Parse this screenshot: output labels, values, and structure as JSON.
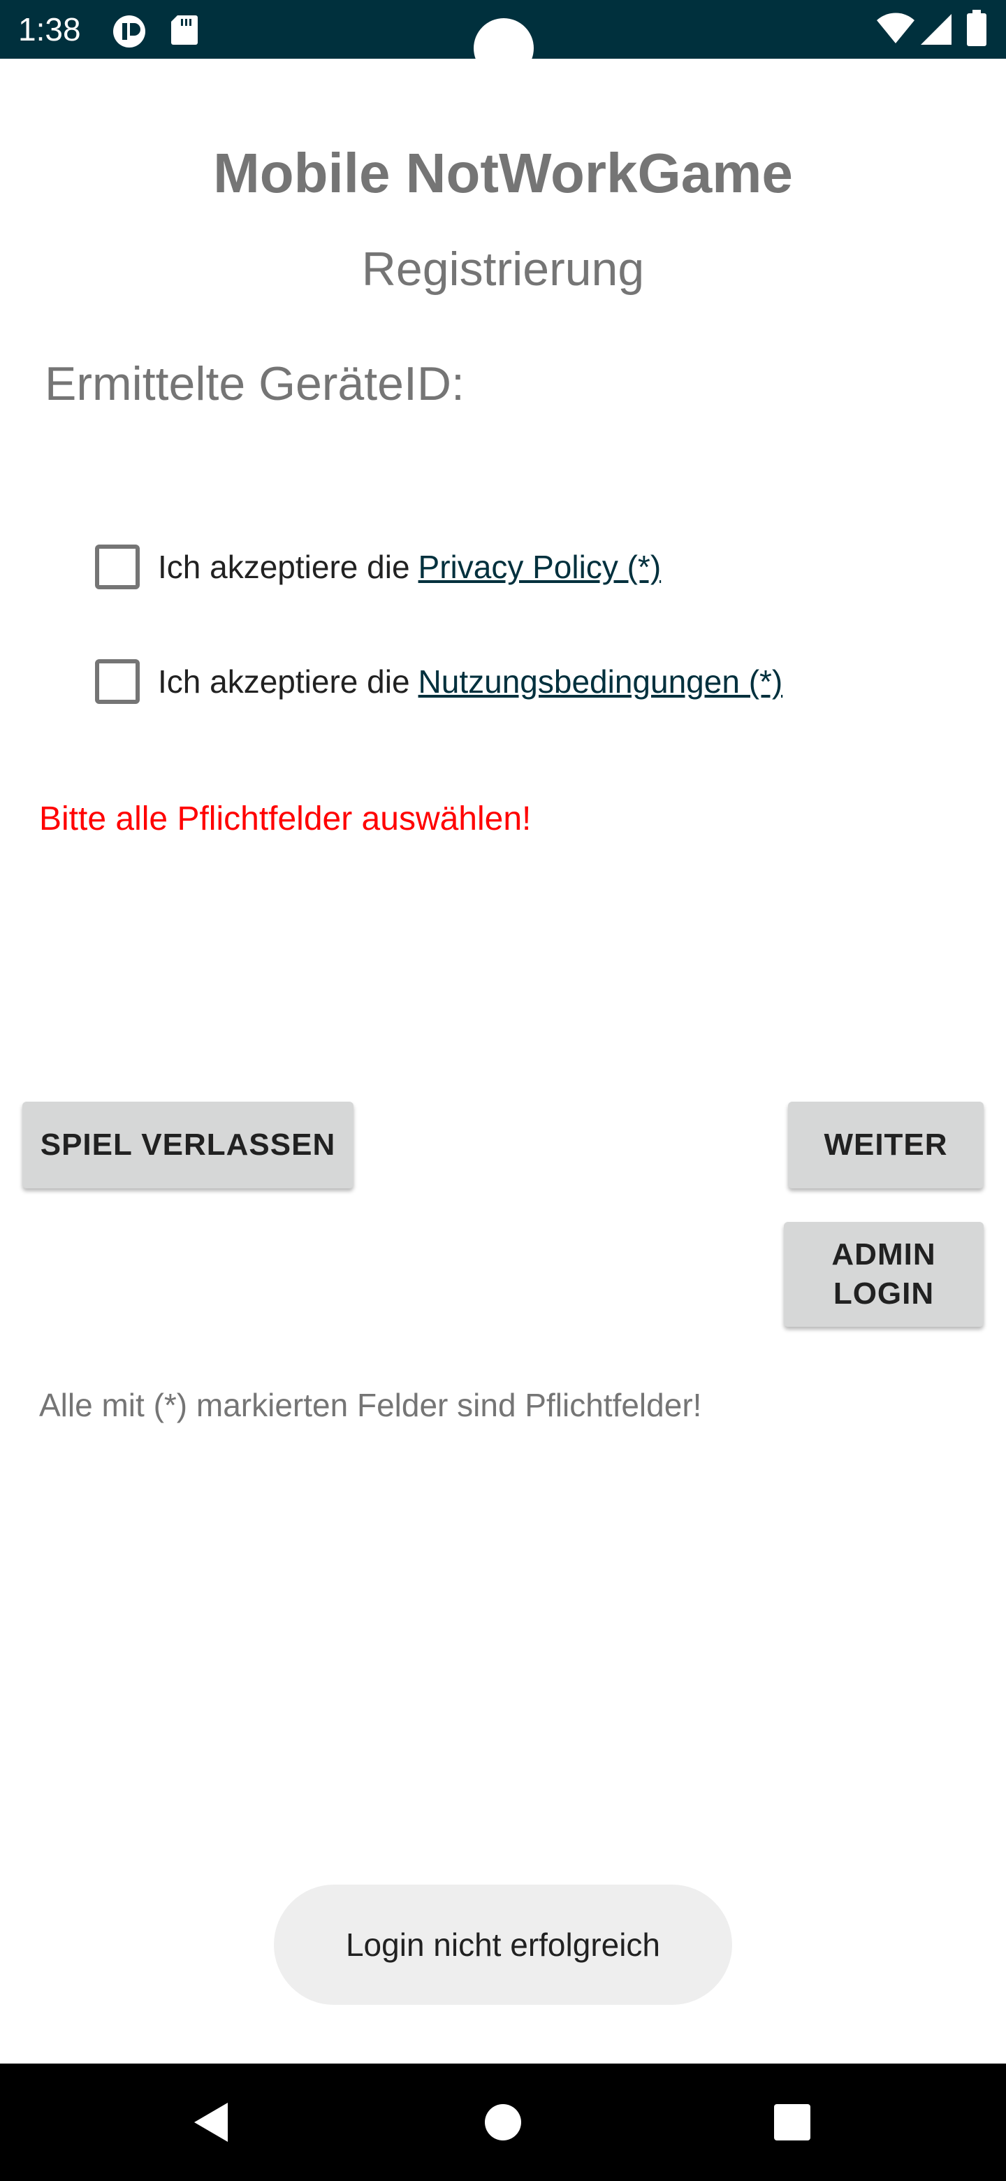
{
  "status_bar": {
    "time": "1:38",
    "icons": [
      "notification-app-icon",
      "sd-card-icon",
      "wifi-icon",
      "signal-icon",
      "battery-icon"
    ]
  },
  "header": {
    "app_title": "Mobile NotWorkGame",
    "subtitle": "Registrierung"
  },
  "device": {
    "label": "Ermittelte GeräteID:"
  },
  "consents": [
    {
      "text": "Ich akzeptiere die",
      "link": "Privacy Policy (*)",
      "checked": false
    },
    {
      "text": "Ich akzeptiere die",
      "link": "Nutzungsbedingungen (*)",
      "checked": false
    }
  ],
  "error": {
    "message": "Bitte alle Pflichtfelder auswählen!",
    "color": "#ff0000"
  },
  "buttons": {
    "leave": "SPIEL VERLASSEN",
    "next": "WEITER",
    "admin": "ADMIN\nLOGIN"
  },
  "hint": "Alle mit (*) markierten Felder sind Pflichtfelder!",
  "toast": "Login nicht erfolgreich",
  "nav_bar": {
    "icons": [
      "back-icon",
      "home-icon",
      "recents-icon"
    ]
  },
  "colors": {
    "status_bar": "#00303d",
    "link": "#00303d",
    "button_bg": "#d6d7d7",
    "muted_text": "#757575"
  }
}
